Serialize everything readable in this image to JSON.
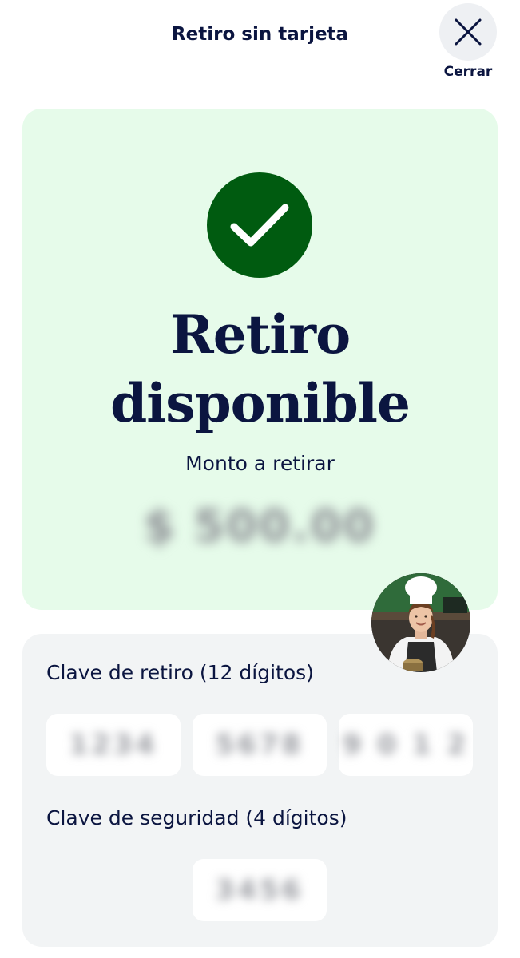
{
  "header": {
    "title": "Retiro sin tarjeta",
    "close_label": "Cerrar",
    "close_icon": "close-icon"
  },
  "success": {
    "icon": "checkmark-icon",
    "title_line1": "Retiro",
    "title_line2": "disponible",
    "amount_label": "Monto a retirar",
    "amount_value": "$ 500.00"
  },
  "codes": {
    "withdrawal_label": "Clave de retiro (12 dígitos)",
    "withdrawal_groups": [
      "1234",
      "5678",
      "9 0 1 2"
    ],
    "security_label": "Clave de seguridad (4 dígitos)",
    "security_code": "3456"
  },
  "colors": {
    "accent_dark": "#0b1540",
    "success_green": "#005b10",
    "success_bg": "#e6fbea",
    "card_bg": "#f2f4f5"
  }
}
